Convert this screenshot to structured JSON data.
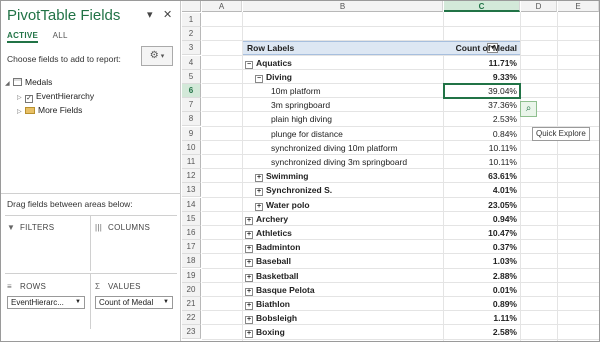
{
  "pane": {
    "title": "PivotTable Fields",
    "dropdown_icon": "chevron-down-icon",
    "close_icon": "close-icon",
    "tabs": [
      {
        "label": "ACTIVE"
      },
      {
        "label": "ALL"
      }
    ],
    "choose_text": "Choose fields to add to report:",
    "gear_icon": "gear-icon",
    "tree": [
      {
        "label": "Medals",
        "type": "table"
      },
      {
        "label": "EventHierarchy",
        "type": "checked-field"
      },
      {
        "label": "More Fields",
        "type": "folder"
      }
    ],
    "drag_text": "Drag fields between areas below:",
    "areas": {
      "filters": "FILTERS",
      "columns": "COLUMNS",
      "rows": "ROWS",
      "values": "VALUES",
      "rows_field": "EventHierarc...",
      "values_field": "Count of Medal"
    }
  },
  "sheet": {
    "columns": [
      "A",
      "B",
      "C",
      "D",
      "E"
    ],
    "selected_column": "C",
    "selected_row": "6",
    "header": {
      "row_labels": "Row Labels",
      "value_header": "Count of Medal"
    },
    "rows": [
      {
        "n": "1",
        "label": "",
        "value": "",
        "level": 0
      },
      {
        "n": "2",
        "label": "",
        "value": "",
        "level": 0
      },
      {
        "n": "3",
        "label": "Row Labels",
        "value": "Count of Medal",
        "level": -1
      },
      {
        "n": "4",
        "label": "Aquatics",
        "value": "11.71%",
        "level": 1,
        "sign": "⊟"
      },
      {
        "n": "5",
        "label": "Diving",
        "value": "9.33%",
        "level": 2,
        "sign": "⊟"
      },
      {
        "n": "6",
        "label": "10m platform",
        "value": "39.04%",
        "level": 3
      },
      {
        "n": "7",
        "label": "3m springboard",
        "value": "37.36%",
        "level": 3
      },
      {
        "n": "8",
        "label": "plain high diving",
        "value": "2.53%",
        "level": 3
      },
      {
        "n": "9",
        "label": "plunge for distance",
        "value": "0.84%",
        "level": 3
      },
      {
        "n": "10",
        "label": "synchronized diving 10m platform",
        "value": "10.11%",
        "level": 3
      },
      {
        "n": "11",
        "label": "synchronized diving 3m springboard",
        "value": "10.11%",
        "level": 3
      },
      {
        "n": "12",
        "label": "Swimming",
        "value": "63.61%",
        "level": 2,
        "sign": "⊞"
      },
      {
        "n": "13",
        "label": "Synchronized S.",
        "value": "4.01%",
        "level": 2,
        "sign": "⊞"
      },
      {
        "n": "14",
        "label": "Water polo",
        "value": "23.05%",
        "level": 2,
        "sign": "⊞"
      },
      {
        "n": "15",
        "label": "Archery",
        "value": "0.94%",
        "level": 1,
        "sign": "⊞"
      },
      {
        "n": "16",
        "label": "Athletics",
        "value": "10.47%",
        "level": 1,
        "sign": "⊞"
      },
      {
        "n": "17",
        "label": "Badminton",
        "value": "0.37%",
        "level": 1,
        "sign": "⊞"
      },
      {
        "n": "18",
        "label": "Baseball",
        "value": "1.03%",
        "level": 1,
        "sign": "⊞"
      },
      {
        "n": "19",
        "label": "Basketball",
        "value": "2.88%",
        "level": 1,
        "sign": "⊞"
      },
      {
        "n": "20",
        "label": "Basque Pelota",
        "value": "0.01%",
        "level": 1,
        "sign": "⊞"
      },
      {
        "n": "21",
        "label": "Biathlon",
        "value": "0.89%",
        "level": 1,
        "sign": "⊞"
      },
      {
        "n": "22",
        "label": "Bobsleigh",
        "value": "1.11%",
        "level": 1,
        "sign": "⊞"
      },
      {
        "n": "23",
        "label": "Boxing",
        "value": "2.58%",
        "level": 1,
        "sign": "⊞"
      }
    ],
    "quick_explore_icon": "magnifier-icon",
    "quick_explore_tip": "Quick Explore"
  },
  "colors": {
    "accent": "#217346",
    "header_band": "#dde7f3"
  }
}
